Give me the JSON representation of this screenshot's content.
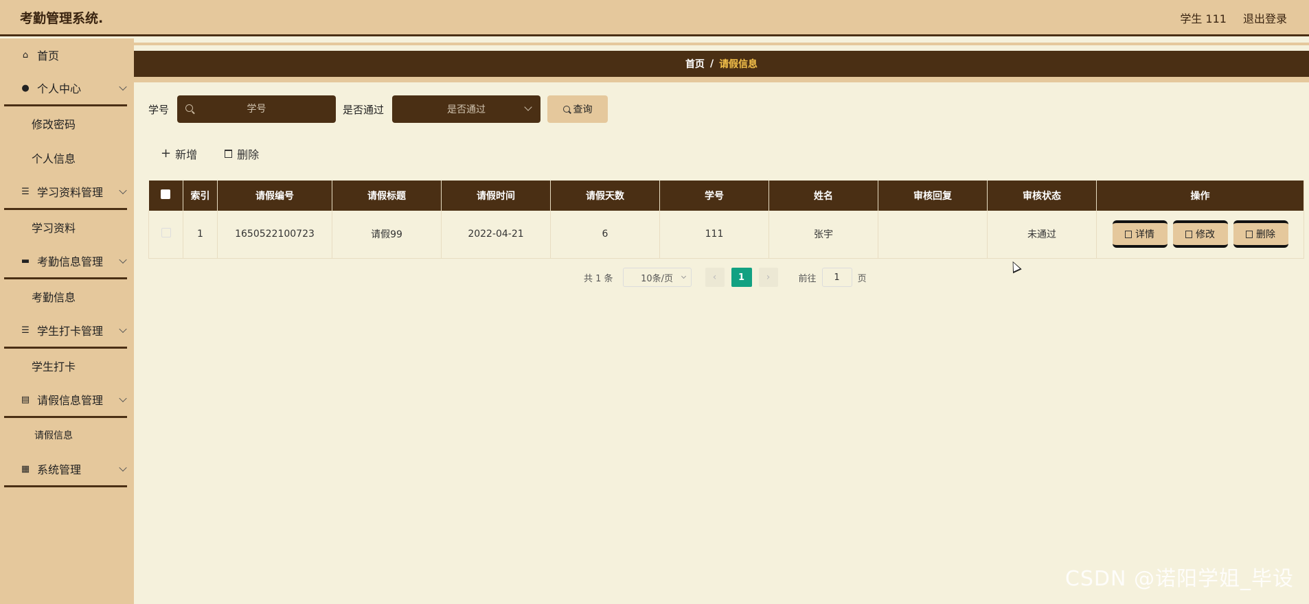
{
  "header": {
    "title": "考勤管理系统.",
    "user": "学生 111",
    "logout": "退出登录"
  },
  "sidebar": {
    "home": "首页",
    "personal_center": "个人中心",
    "change_password": "修改密码",
    "personal_info": "个人信息",
    "study_mgmt": "学习资料管理",
    "study_material": "学习资料",
    "attendance_mgmt": "考勤信息管理",
    "attendance_info": "考勤信息",
    "checkin_mgmt": "学生打卡管理",
    "checkin": "学生打卡",
    "leave_mgmt": "请假信息管理",
    "leave_info": "请假信息",
    "system_mgmt": "系统管理"
  },
  "breadcrumb": {
    "home": "首页",
    "sep": "/",
    "current": "请假信息"
  },
  "search": {
    "label_id": "学号",
    "placeholder_id": "学号",
    "label_pass": "是否通过",
    "select_pass": "是否通过",
    "query": "查询"
  },
  "actions": {
    "add": "新增",
    "delete": "删除"
  },
  "table": {
    "headers": [
      "索引",
      "请假编号",
      "请假标题",
      "请假时间",
      "请假天数",
      "学号",
      "姓名",
      "审核回复",
      "审核状态",
      "操作"
    ],
    "rows": [
      {
        "index": "1",
        "leave_no": "1650522100723",
        "title": "请假99",
        "time": "2022-04-21",
        "days": "6",
        "student_id": "111",
        "name": "张宇",
        "reply": "",
        "status": "未通过"
      }
    ],
    "op_detail": "详情",
    "op_edit": "修改",
    "op_delete": "删除"
  },
  "pagination": {
    "total": "共 1 条",
    "page_size": "10条/页",
    "current_page": "1",
    "goto_prefix": "前往",
    "goto_value": "1",
    "goto_suffix": "页"
  },
  "watermark": "CSDN @诺阳学姐_毕设"
}
